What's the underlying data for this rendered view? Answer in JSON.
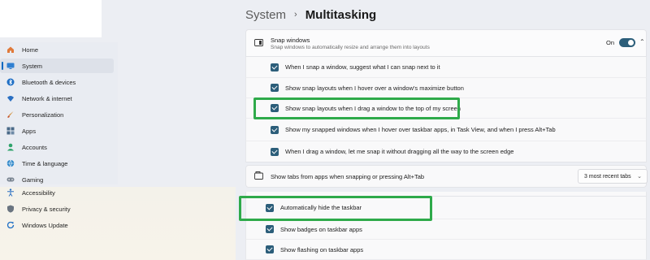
{
  "header": {
    "section": "System",
    "separator": "›",
    "page": "Multitasking"
  },
  "sidebar": {
    "items": [
      {
        "label": "Home",
        "icon": "home-icon"
      },
      {
        "label": "System",
        "icon": "monitor-icon",
        "active": true
      },
      {
        "label": "Bluetooth & devices",
        "icon": "bluetooth-icon"
      },
      {
        "label": "Network & internet",
        "icon": "wifi-icon"
      },
      {
        "label": "Personalization",
        "icon": "brush-icon"
      },
      {
        "label": "Apps",
        "icon": "apps-icon"
      },
      {
        "label": "Accounts",
        "icon": "person-icon"
      },
      {
        "label": "Time & language",
        "icon": "globe-icon"
      },
      {
        "label": "Gaming",
        "icon": "gamepad-icon"
      },
      {
        "label": "Accessibility",
        "icon": "accessibility-icon"
      },
      {
        "label": "Privacy & security",
        "icon": "shield-icon"
      },
      {
        "label": "Windows Update",
        "icon": "update-icon"
      }
    ]
  },
  "snap": {
    "title": "Snap windows",
    "description": "Snap windows to automatically resize and arrange them into layouts",
    "toggle_state": "On",
    "options": [
      "When I snap a window, suggest what I can snap next to it",
      "Show snap layouts when I hover over a window's maximize button",
      "Show snap layouts when I drag a window to the top of my screen",
      "Show my snapped windows when I hover over taskbar apps, in Task View, and when I press Alt+Tab",
      "When I drag a window, let me snap it without dragging all the way to the screen edge"
    ]
  },
  "tabs": {
    "label": "Show tabs from apps when snapping or pressing Alt+Tab",
    "selected": "3 most recent tabs"
  },
  "taskbar": {
    "options": [
      "Automatically hide the taskbar",
      "Show badges on taskbar apps",
      "Show flashing on taskbar apps"
    ]
  },
  "colors": {
    "accent": "#2c5e7a",
    "highlight": "#2eaa4a",
    "nav_active": "#0067c0"
  }
}
